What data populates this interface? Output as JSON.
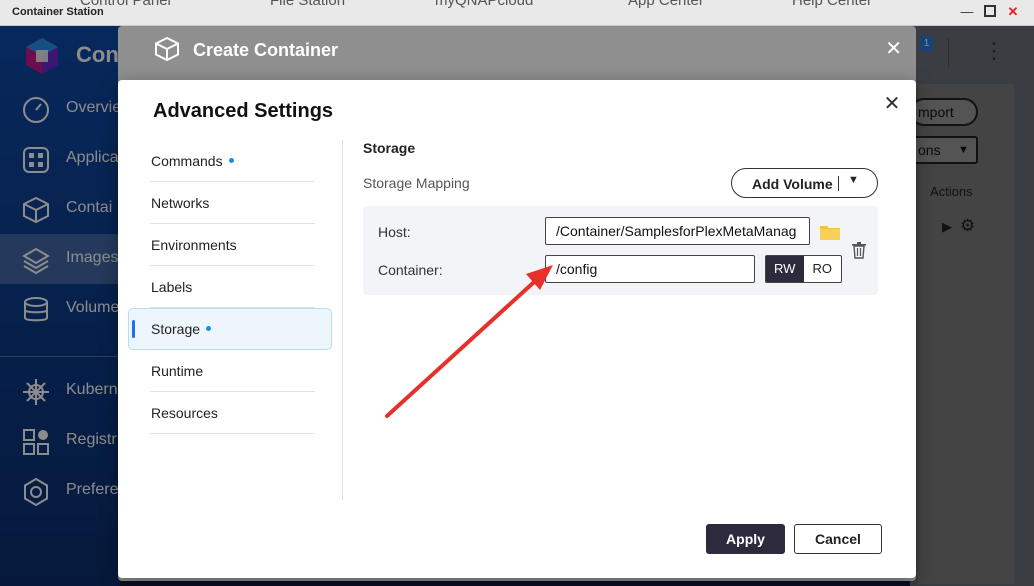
{
  "window": {
    "title": "Container Station",
    "bg_tabs": [
      "Control Panel",
      "File Station",
      "myQNAPcloud",
      "App Center",
      "Help Center"
    ]
  },
  "app": {
    "name": "Con",
    "badge": "1",
    "sidebar": [
      {
        "label": "Overvie",
        "icon": "speedometer-icon"
      },
      {
        "label": "Applica",
        "icon": "grid-icon"
      },
      {
        "label": "Contai",
        "icon": "cube-icon"
      },
      {
        "label": "Images",
        "icon": "layers-icon",
        "active": true
      },
      {
        "label": "Volume",
        "icon": "database-icon"
      },
      {
        "label": "Kuberne",
        "icon": "helm-icon"
      },
      {
        "label": "Registr",
        "icon": "registry-icon"
      },
      {
        "label": "Prefere",
        "icon": "gear-icon"
      }
    ],
    "right": {
      "import_label": "mport",
      "actions_menu_label": "ons",
      "actions_col": "Actions"
    }
  },
  "create_dialog": {
    "title": "Create Container"
  },
  "advanced": {
    "title": "Advanced Settings",
    "menu": [
      {
        "label": "Commands",
        "dot": true
      },
      {
        "label": "Networks",
        "dot": false
      },
      {
        "label": "Environments",
        "dot": false
      },
      {
        "label": "Labels",
        "dot": false
      },
      {
        "label": "Storage",
        "dot": true,
        "active": true
      },
      {
        "label": "Runtime",
        "dot": false
      },
      {
        "label": "Resources",
        "dot": false
      }
    ],
    "storage": {
      "section_title": "Storage",
      "mapping_label": "Storage Mapping",
      "add_volume_label": "Add Volume",
      "host_label": "Host:",
      "host_value": "/Container/SamplesforPlexMetaManag",
      "container_label": "Container:",
      "container_value": "/config",
      "rw_label": "RW",
      "ro_label": "RO",
      "mode_selected": "RW"
    },
    "apply_label": "Apply",
    "cancel_label": "Cancel"
  },
  "colors": {
    "accent_dark": "#2d2a3e",
    "dot_blue": "#1a8fe0",
    "arrow_red": "#e8302a",
    "folder_yellow": "#f5c242"
  }
}
